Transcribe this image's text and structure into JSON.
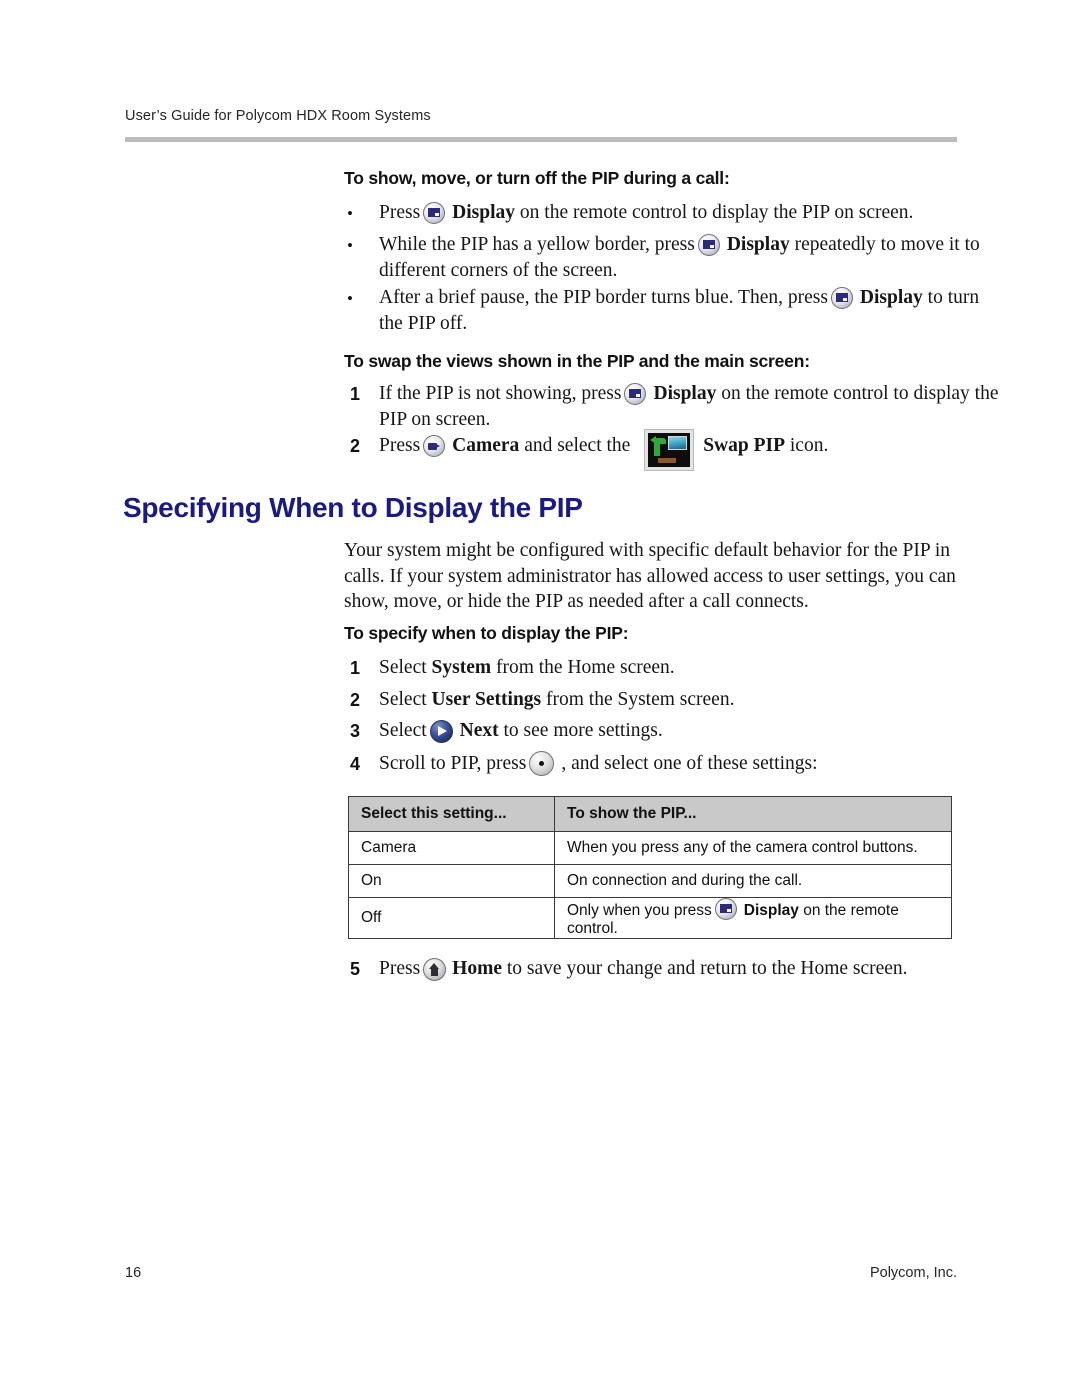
{
  "header": {
    "running_title": "User’s Guide for Polycom HDX Room Systems"
  },
  "section_pip_during_call": {
    "heading": "To show, move, or turn off the PIP during a call:",
    "bullets": [
      {
        "before": "Press",
        "icon": "display-button-icon",
        "bold": "Display",
        "after": "on the remote control to display the PIP on screen."
      },
      {
        "before": "While the PIP has a yellow border, press",
        "icon": "display-button-icon",
        "bold": "Display",
        "after": "repeatedly to move it to different corners of the screen."
      },
      {
        "before": "After a brief pause, the PIP border turns blue. Then, press",
        "icon": "display-button-icon",
        "bold": "Display",
        "after": "to turn the PIP off."
      }
    ]
  },
  "section_swap_views": {
    "heading": "To swap the views shown in the PIP and the main screen:",
    "steps": [
      {
        "number": "1",
        "before": "If the PIP is not showing, press",
        "icon": "display-button-icon",
        "bold": "Display",
        "after": "on the remote control to display the PIP on screen."
      },
      {
        "number": "2",
        "before": "Press",
        "icon": "camera-button-icon",
        "bold": "Camera",
        "middle": "and select the",
        "thumbnail": "swap-pip-thumbnail",
        "bold2": "Swap PIP",
        "after": "icon."
      }
    ]
  },
  "section_specifying": {
    "title": "Specifying When to Display the PIP",
    "title_color": "#1a1a80",
    "paragraph": "Your system might be configured with specific default behavior for the PIP in calls. If your system administrator has allowed access to user settings, you can show, move, or hide the PIP as needed after a call connects.",
    "procedure_heading": "To specify when to display the PIP:",
    "steps": [
      {
        "number": "1",
        "before": "Select",
        "bold": "System",
        "after": "from the Home screen."
      },
      {
        "number": "2",
        "before": "Select",
        "bold": "User Settings",
        "after": "from the System screen."
      },
      {
        "number": "3",
        "before": "Select",
        "icon": "next-button-icon",
        "bold": "Next",
        "after": "to see more settings."
      },
      {
        "number": "4",
        "before": "Scroll to PIP, press",
        "icon": "select-button-icon",
        "after": ", and select one of these settings:"
      },
      {
        "number": "5",
        "before": "Press",
        "icon": "home-button-icon",
        "bold": "Home",
        "after": "to save your change and return to the Home screen."
      }
    ],
    "table": {
      "columns": [
        "Select this setting...",
        "To show the PIP..."
      ],
      "header_background": "#c9c9c9",
      "rows": [
        {
          "setting": "Camera",
          "description": "When you press any of the camera control buttons."
        },
        {
          "setting": "On",
          "description": "On connection and during the call."
        },
        {
          "setting": "Off",
          "description_before": "Only when you press",
          "description_icon": "display-button-icon",
          "description_bold": "Display",
          "description_after": "on the remote control."
        }
      ]
    }
  },
  "footer": {
    "page_number": "16",
    "company": "Polycom, Inc."
  }
}
